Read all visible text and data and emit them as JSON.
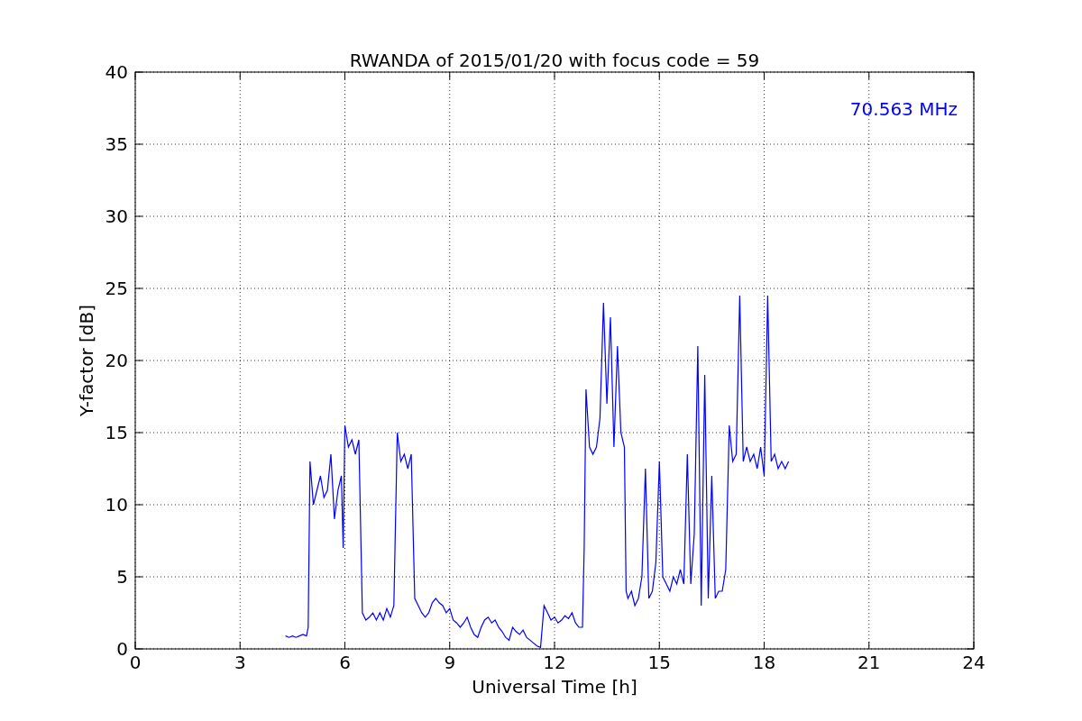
{
  "figure": {
    "chart_data": {
      "type": "line",
      "title": "RWANDA of 2015/01/20 with focus code = 59",
      "xlabel": "Universal Time [h]",
      "ylabel": "Y-factor [dB]",
      "xlim": [
        0,
        24
      ],
      "ylim": [
        0,
        40
      ],
      "xticks": [
        0,
        3,
        6,
        9,
        12,
        15,
        18,
        21,
        24
      ],
      "yticks": [
        0,
        5,
        10,
        15,
        20,
        25,
        30,
        35,
        40
      ],
      "grid": true,
      "annotations": [
        {
          "text": "70.563 MHz"
        }
      ],
      "x": [
        4.3,
        4.4,
        4.5,
        4.6,
        4.7,
        4.8,
        4.9,
        4.95,
        5.0,
        5.1,
        5.2,
        5.3,
        5.4,
        5.5,
        5.6,
        5.7,
        5.8,
        5.9,
        5.95,
        6.0,
        6.1,
        6.2,
        6.3,
        6.4,
        6.5,
        6.6,
        6.7,
        6.8,
        6.9,
        7.0,
        7.1,
        7.2,
        7.3,
        7.4,
        7.5,
        7.6,
        7.7,
        7.8,
        7.9,
        8.0,
        8.1,
        8.2,
        8.3,
        8.4,
        8.5,
        8.6,
        8.7,
        8.8,
        8.9,
        9.0,
        9.1,
        9.2,
        9.3,
        9.4,
        9.5,
        9.6,
        9.7,
        9.8,
        9.9,
        10.0,
        10.1,
        10.2,
        10.3,
        10.4,
        10.5,
        10.6,
        10.7,
        10.8,
        10.9,
        11.0,
        11.1,
        11.2,
        11.3,
        11.4,
        11.5,
        11.6,
        11.7,
        11.8,
        11.9,
        12.0,
        12.1,
        12.2,
        12.3,
        12.4,
        12.5,
        12.6,
        12.7,
        12.8,
        12.85,
        12.9,
        13.0,
        13.1,
        13.2,
        13.3,
        13.4,
        13.5,
        13.6,
        13.7,
        13.8,
        13.9,
        14.0,
        14.05,
        14.1,
        14.2,
        14.3,
        14.4,
        14.5,
        14.6,
        14.7,
        14.8,
        14.9,
        15.0,
        15.1,
        15.2,
        15.3,
        15.4,
        15.5,
        15.6,
        15.7,
        15.8,
        15.9,
        16.0,
        16.1,
        16.2,
        16.3,
        16.4,
        16.5,
        16.6,
        16.7,
        16.8,
        16.9,
        17.0,
        17.1,
        17.2,
        17.3,
        17.4,
        17.5,
        17.6,
        17.7,
        17.8,
        17.9,
        18.0,
        18.1,
        18.2,
        18.3,
        18.4,
        18.5,
        18.6,
        18.7
      ],
      "series": [
        {
          "color": "#0000ff",
          "values": [
            0.9,
            0.8,
            0.9,
            0.8,
            0.9,
            1.0,
            0.9,
            1.5,
            13,
            10,
            11,
            12,
            10.5,
            11,
            13.5,
            9,
            11,
            12,
            7,
            15.5,
            14,
            14.5,
            13.5,
            14.5,
            2.5,
            2,
            2.2,
            2.5,
            2,
            2.5,
            2,
            2.8,
            2.2,
            3,
            15,
            13,
            13.5,
            12.5,
            13.5,
            3.5,
            3,
            2.5,
            2.2,
            2.5,
            3.2,
            3.5,
            3.2,
            3,
            2.5,
            2.8,
            2,
            1.8,
            1.5,
            1.8,
            2.2,
            1.5,
            1,
            0.8,
            1.5,
            2,
            2.2,
            1.8,
            2,
            1.5,
            1.2,
            0.8,
            0.6,
            1.5,
            1.2,
            1,
            1.3,
            0.8,
            0.6,
            0.4,
            0.2,
            0.1,
            3,
            2.5,
            2,
            2.2,
            1.8,
            2,
            2.3,
            2.1,
            2.5,
            1.8,
            1.5,
            1.5,
            7,
            18,
            14,
            13.5,
            14,
            16,
            24,
            17,
            23,
            14,
            21,
            15,
            14,
            4,
            3.5,
            4,
            3,
            3.5,
            5,
            12.5,
            3.5,
            4,
            6,
            13,
            5,
            4.5,
            4,
            5,
            4.5,
            5.5,
            4.5,
            13.5,
            4.5,
            8,
            21,
            3,
            19,
            3.5,
            12,
            3.5,
            4,
            4,
            5.5,
            15.5,
            13,
            13.5,
            24.5,
            13,
            14,
            13,
            13.5,
            12.5,
            14,
            12,
            24.5,
            13,
            13.5,
            12.5,
            13,
            12.5,
            13
          ]
        }
      ]
    }
  }
}
